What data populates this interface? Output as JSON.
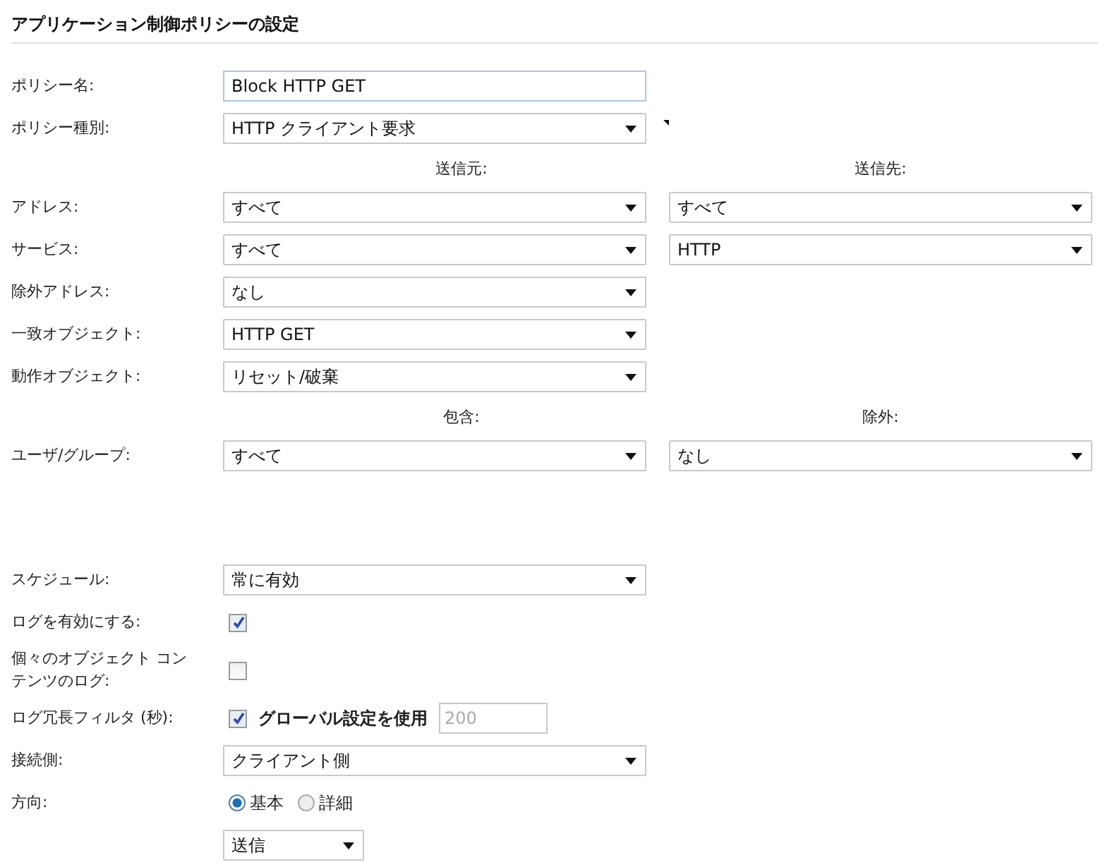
{
  "title": "アプリケーション制御ポリシーの設定",
  "policy_fields": [
    {
      "kind": "text",
      "label": "ポリシー名:",
      "value": "Block HTTP GET"
    },
    {
      "kind": "select",
      "label": "ポリシー種別:",
      "value": "HTTP クライアント要求",
      "marker": true
    },
    {
      "kind": "header",
      "left": "送信元:",
      "right": "送信先:"
    },
    {
      "kind": "select2",
      "label": "アドレス:",
      "values": [
        "すべて",
        "すべて"
      ]
    },
    {
      "kind": "select2",
      "label": "サービス:",
      "values": [
        "すべて",
        "HTTP"
      ]
    },
    {
      "kind": "select",
      "label": "除外アドレス:",
      "value": "なし"
    },
    {
      "kind": "select",
      "label": "一致オブジェクト:",
      "value": "HTTP GET"
    },
    {
      "kind": "select",
      "label": "動作オブジェクト:",
      "value": "リセット/破棄"
    },
    {
      "kind": "header",
      "left": "包含:",
      "right": "除外:"
    },
    {
      "kind": "select2",
      "label": "ユーザ/グループ:",
      "values": [
        "すべて",
        "なし"
      ]
    }
  ],
  "log_fields": [
    {
      "kind": "select",
      "label": "スケジュール:",
      "value": "常に有効"
    },
    {
      "kind": "checkbox",
      "label": "ログを有効にする:",
      "checked": true
    },
    {
      "kind": "checkbox",
      "label": "個々のオブジェクト コンテンツのログ:",
      "checked": false
    },
    {
      "kind": "checkbox_number",
      "label": "ログ冗長フィルタ (秒):",
      "checked": true,
      "check_label": "グローバル設定を使用",
      "value": "200",
      "disabled": true
    },
    {
      "kind": "select",
      "label": "接続側:",
      "value": "クライアント側"
    },
    {
      "kind": "radio",
      "label": "方向:",
      "options": [
        {
          "label": "基本",
          "selected": true
        },
        {
          "label": "詳細",
          "selected": false
        }
      ]
    },
    {
      "kind": "select_small",
      "value": "送信"
    }
  ]
}
